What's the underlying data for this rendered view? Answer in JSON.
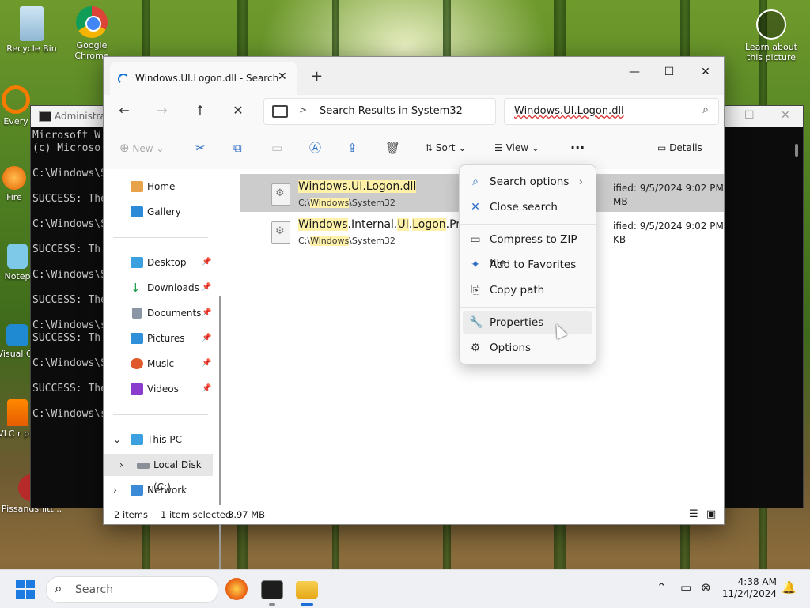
{
  "desktop": {
    "icons": [
      {
        "label": "Recycle Bin"
      },
      {
        "label": "Google Chrome"
      },
      {
        "label": "Every"
      },
      {
        "label": "Fire"
      },
      {
        "label": "Notep"
      },
      {
        "label": "Visual Co"
      },
      {
        "label": "VLC r pla"
      },
      {
        "label": "Pissandshitt..."
      },
      {
        "label": "Learn about this picture"
      }
    ]
  },
  "terminal": {
    "title": "Administra",
    "lines": "Microsoft W\n(c) Microso\n\nC:\\Windows\\S\n\nSUCCESS: The\n\nC:\\Windows\\S\n\nSUCCESS: Th\n\nC:\\Windows\\S\n\nSUCCESS: The\n\nC:\\Windows\\s\nSUCCESS: Th\n\nC:\\Windows\\S\n\nSUCCESS: The\n\nC:\\Windows\\s"
  },
  "explorer": {
    "tab_title": "Windows.UI.Logon.dll - Search",
    "address": {
      "chevron": ">",
      "path": "Search Results in System32"
    },
    "search_value": "Windows.UI.Logon.dll",
    "toolbar": {
      "new_label": "New",
      "sort_label": "Sort",
      "view_label": "View",
      "more_label": "···",
      "details_label": "Details"
    },
    "sidebar": {
      "home": "Home",
      "gallery": "Gallery",
      "desktop": "Desktop",
      "downloads": "Downloads",
      "documents": "Documents",
      "pictures": "Pictures",
      "music": "Music",
      "videos": "Videos",
      "this_pc": "This PC",
      "local_disk": "Local Disk (C:)",
      "network": "Network"
    },
    "results": [
      {
        "name_hl1": "Windows.UI.Logon.dll",
        "path_hl": "Windows",
        "path_pre": "C:\\",
        "path_post": "\\System32",
        "meta1": "ified: 9/5/2024 9:02 PM",
        "meta2": "MB"
      },
      {
        "name_hl1": "Windows",
        "name_mid1": ".Internal.",
        "name_hl2": "UI",
        "name_mid2": ".",
        "name_hl3": "Logon",
        "name_post": ".Prox",
        "path_hl": "Windows",
        "path_pre": "C:\\",
        "path_post": "\\System32",
        "meta1": "ified: 9/5/2024 9:02 PM",
        "meta2": "KB"
      }
    ],
    "status": {
      "items": "2 items",
      "selected": "1 item selected",
      "size": "3.97 MB"
    }
  },
  "context_menu": {
    "search_options": "Search options",
    "close_search": "Close search",
    "compress": "Compress to ZIP file",
    "favorites": "Add to Favorites",
    "copy_path": "Copy path",
    "properties": "Properties",
    "options": "Options"
  },
  "taskbar": {
    "search_placeholder": "Search",
    "time": "4:38 AM",
    "date": "11/24/2024"
  }
}
